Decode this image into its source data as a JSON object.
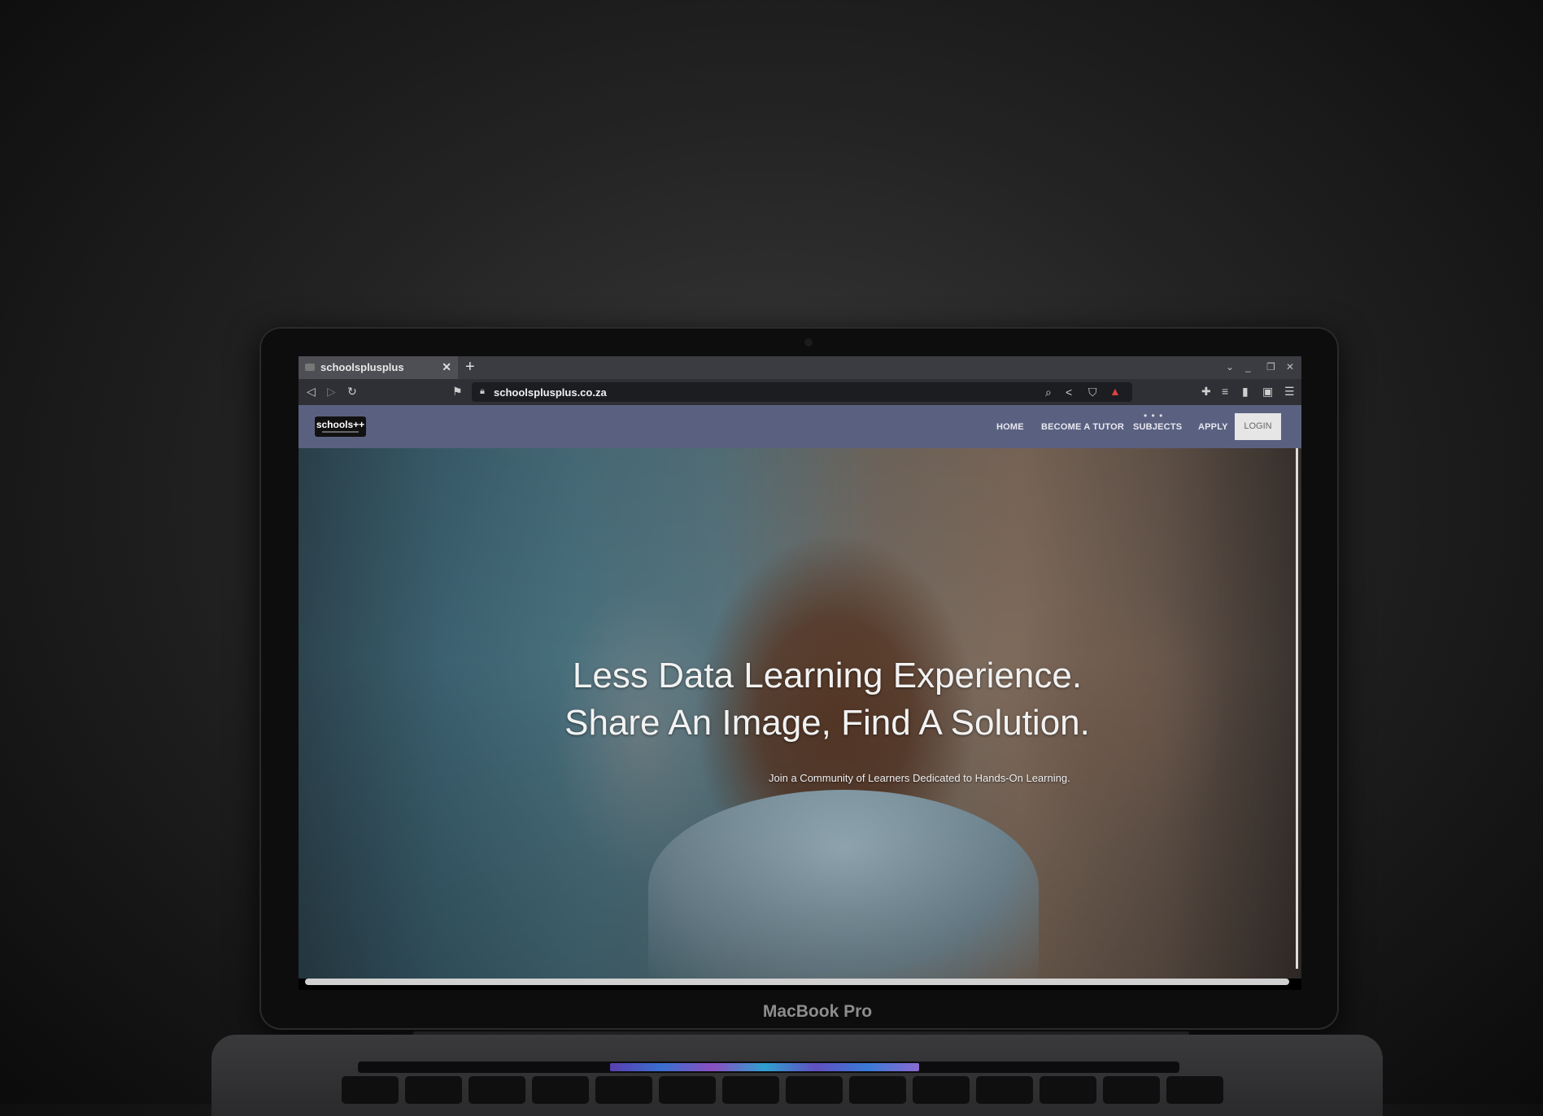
{
  "browser": {
    "tab_title": "schoolsplusplus",
    "url": "schoolsplusplus.co.za"
  },
  "site": {
    "logo_text": "schools++",
    "nav": [
      "HOME",
      "BECOME A TUTOR",
      "SUBJECTS",
      "APPLY"
    ],
    "login_label": "LOGIN",
    "nav_bg_color": "#5a6180"
  },
  "hero": {
    "headline_line1": "Less Data Learning Experience.",
    "headline_line2": "Share An Image, Find A Solution.",
    "subline": "Join a Community of Learners Dedicated to Hands-On Learning."
  },
  "device": {
    "brand_label": "MacBook Pro"
  }
}
